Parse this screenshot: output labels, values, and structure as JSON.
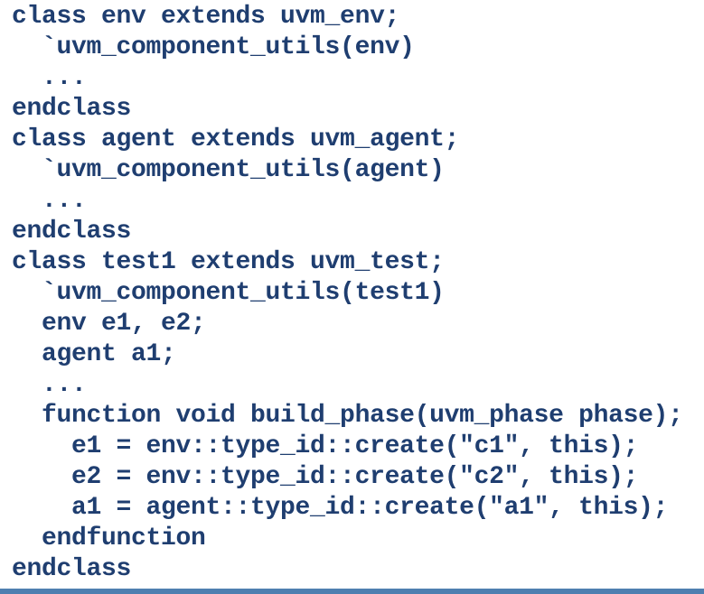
{
  "code": {
    "lines": [
      "class env extends uvm_env;",
      "  `uvm_component_utils(env)",
      "  ...",
      "endclass",
      "class agent extends uvm_agent;",
      "  `uvm_component_utils(agent)",
      "  ...",
      "endclass",
      "class test1 extends uvm_test;",
      "  `uvm_component_utils(test1)",
      "  env e1, e2;",
      "  agent a1;",
      "  ...",
      "  function void build_phase(uvm_phase phase);",
      "    e1 = env::type_id::create(\"c1\", this);",
      "    e2 = env::type_id::create(\"c2\", this);",
      "    a1 = agent::type_id::create(\"a1\", this);",
      "  endfunction",
      "endclass"
    ]
  },
  "colors": {
    "code_text": "#1f3e70",
    "background": "#ffffff",
    "bottom_rule": "#4f7fb0"
  }
}
